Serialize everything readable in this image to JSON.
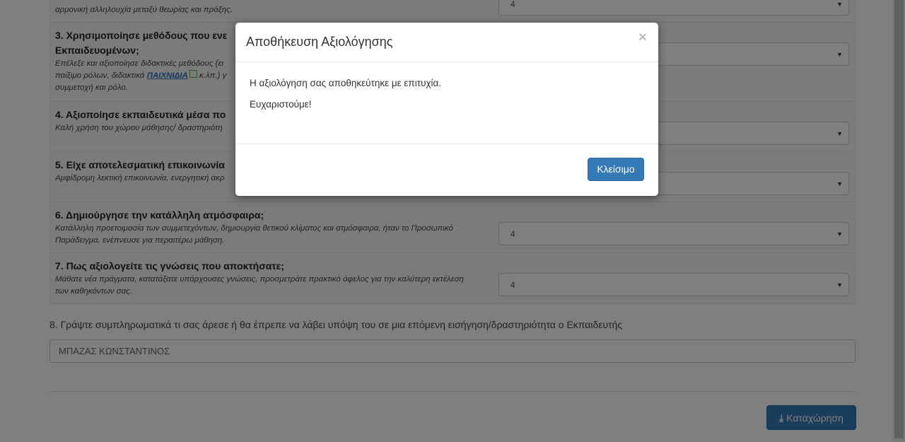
{
  "rows": [
    {
      "desc": "αρμονική αλληλουχία μεταξύ θεωρίας και πράξης.",
      "value": "4"
    },
    {
      "title": "3. Χρησιμοποίησε μεθόδους που ενε",
      "title2": "Εκπαιδευομένων;",
      "desc1": "Επέλεξε και αξιοποίησε διδακτικές μεθόδους (ει",
      "desc2_a": "παίξιμο ρόλων, διδακτικά ",
      "desc2_link": "ΠΑΙΧΝΙΔΙΑ",
      "desc2_b": " κ.λπ.) γ",
      "desc3": "συμμετοχή και ρόλο."
    },
    {
      "title": "4. Αξιοποίησε εκπαιδευτικά μέσα πο",
      "desc": "Καλή χρήση του χώρου μάθησης/ δραστηριότη"
    },
    {
      "title": "5. Είχε αποτελεσματική επικοινωνία",
      "desc": "Αμφίδρομη λεκτική επικοινωνία, ενεργητική ακρ"
    },
    {
      "title": "6. Δημιούργησε την κατάλληλη ατμόσφαιρα;",
      "desc1": "Κατάλληλη προετοιμασία των συμμετεχόντων, δημιουργία θετικού κλίματος και ατμόσφαιρα, ήταν το Προσωπικό",
      "desc2": "Παράδειγμα, ενέπνευσε για περαιτέρω μάθηση.",
      "value": "4"
    },
    {
      "title": "7. Πως αξιολογείτε τις γνώσεις που αποκτήσατε;",
      "desc1": "Μάθατε νέα πράγματα, κατατάξατε υπάρχουσες γνώσεις, προσμετράτε πρακτικό όφελος για την καλύτερη εκτέλεση",
      "desc2": "των καθηκόντων σας.",
      "value": "4"
    }
  ],
  "free_text": {
    "label": "8. Γράψτε συμπληρωματικά τι σας άρεσε ή θα έπρεπε να λάβει υπόψη του σε μια επόμενη εισήγηση/δραστηριότητα ο Εκπαιδευτής",
    "value": "ΜΠΑΖΑΣ ΚΩΝΣΤΑΝΤΙΝΟΣ"
  },
  "submit_label": "Καταχώρηση",
  "modal": {
    "title": "Αποθήκευση Αξιολόγησης",
    "close_symbol": "×",
    "message": "Η αξιολόγηση σας αποθηκεύτηκε με επιτυχία.",
    "thanks": "Ευχαριστούμε!",
    "button": "Κλείσιμο"
  }
}
